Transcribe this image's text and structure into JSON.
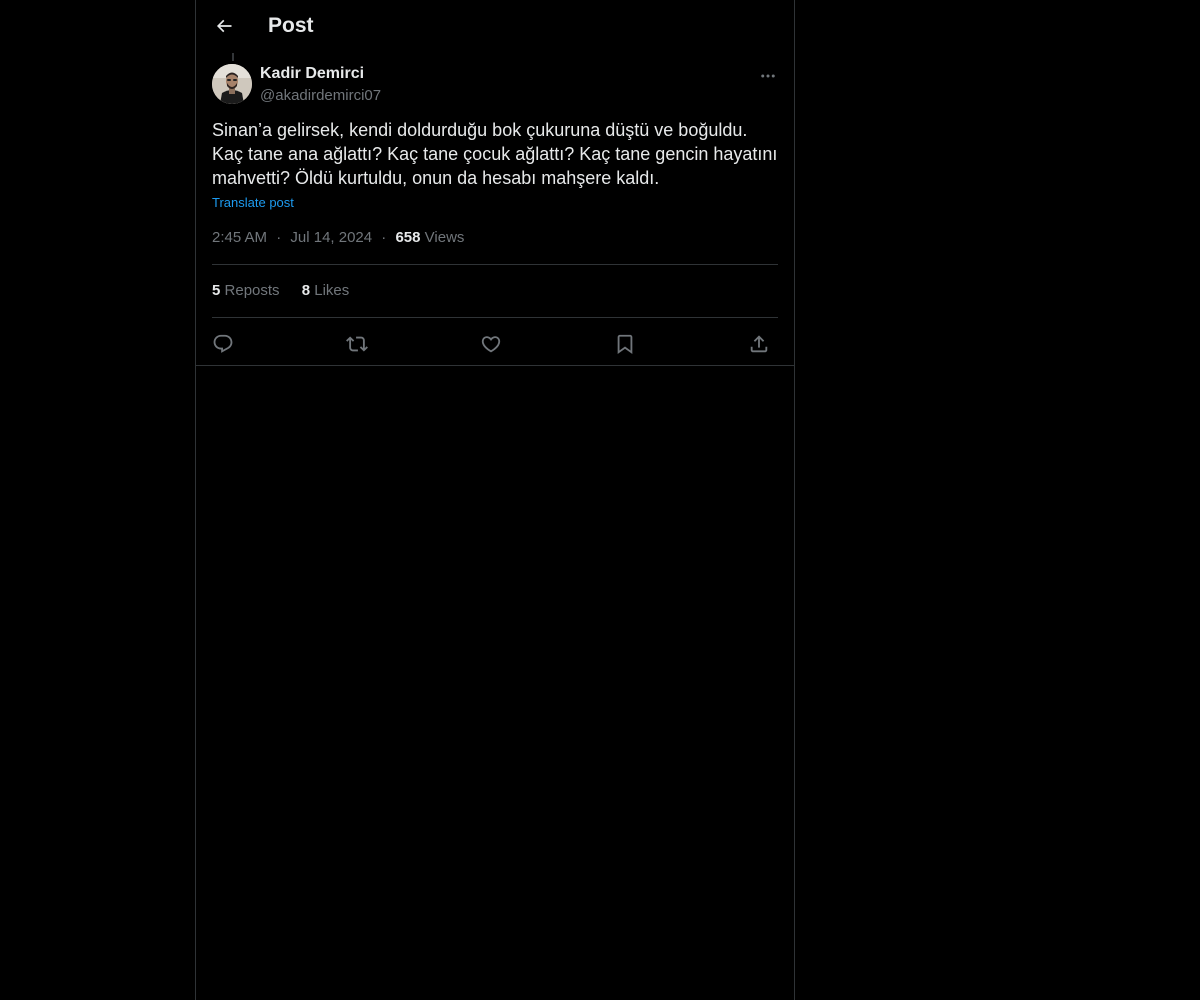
{
  "header": {
    "title": "Post",
    "back_icon": "arrow-left-icon"
  },
  "post": {
    "author_name": "Kadir Demirci",
    "author_handle": "@akadirdemirci07",
    "text": "Sinan’a gelirsek, kendi doldurduğu bok çukuruna düştü ve boğuldu.\nKaç tane ana ağlattı? Kaç tane çocuk ağlattı? Kaç tane gencin hayatını mahvetti? Öldü kurtuldu, onun da hesabı mahşere kaldı.",
    "translate_label": "Translate post",
    "time": "2:45 AM",
    "separator": "·",
    "date": "Jul 14, 2024",
    "views_count": "658",
    "views_label": "Views"
  },
  "stats": {
    "reposts_count": "5",
    "reposts_label": "Reposts",
    "likes_count": "8",
    "likes_label": "Likes"
  },
  "actions": [
    {
      "icon": "reply-icon"
    },
    {
      "icon": "repost-icon"
    },
    {
      "icon": "like-icon"
    },
    {
      "icon": "bookmark-icon"
    },
    {
      "icon": "share-icon"
    }
  ],
  "colors": {
    "background": "#000000",
    "text": "#e7e9ea",
    "secondary_text": "#71767b",
    "link": "#1d9bf0",
    "border": "#2f3336"
  }
}
